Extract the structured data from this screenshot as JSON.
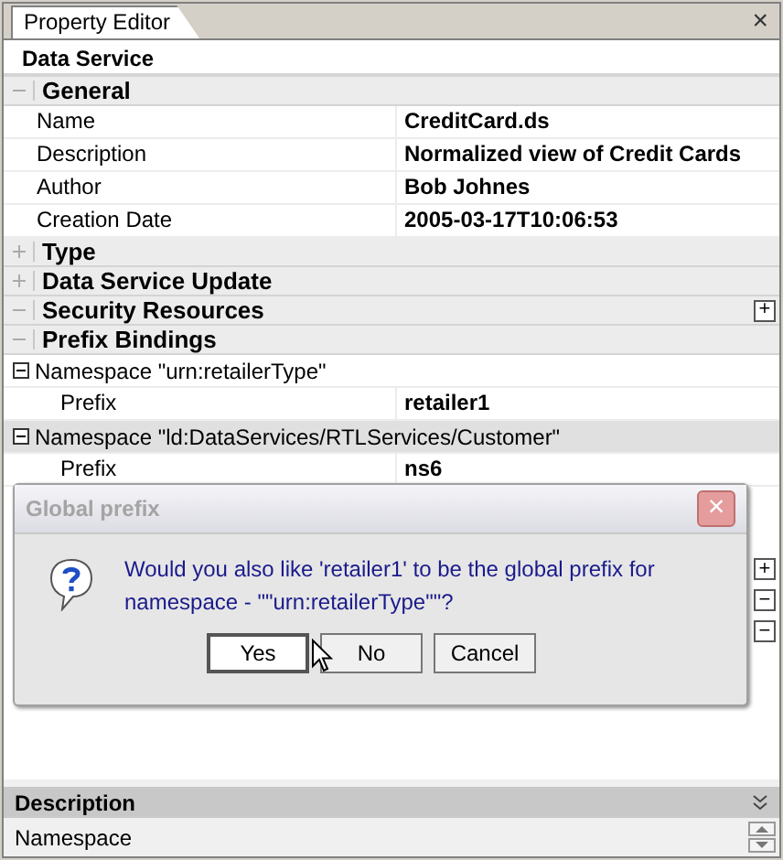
{
  "tab": {
    "label": "Property Editor",
    "close": "×"
  },
  "object_title": "Data Service",
  "rows": [
    {
      "kind": "category",
      "label": "General",
      "expanded": true
    },
    {
      "kind": "property",
      "name": "Name",
      "value": "CreditCard.ds"
    },
    {
      "kind": "property",
      "name": "Description",
      "value": "Normalized view of Credit Cards"
    },
    {
      "kind": "property",
      "name": "Author",
      "value": "Bob Johnes"
    },
    {
      "kind": "property",
      "name": "Creation Date",
      "value": "2005-03-17T10:06:53"
    },
    {
      "kind": "category",
      "label": "Type",
      "expanded": false
    },
    {
      "kind": "category",
      "label": "Data Service Update",
      "expanded": false
    },
    {
      "kind": "category",
      "label": "Security Resources",
      "expanded": true,
      "add_button": "+"
    },
    {
      "kind": "category",
      "label": "Prefix Bindings",
      "expanded": true
    },
    {
      "kind": "namespace",
      "label": "Namespace \"urn:retailerType\"",
      "expanded": true,
      "selected": false
    },
    {
      "kind": "subproperty",
      "name": "Prefix",
      "value": "retailer1"
    },
    {
      "kind": "namespace",
      "label": "Namespace \"ld:DataServices/RTLServices/Customer\"",
      "expanded": true,
      "selected": true
    },
    {
      "kind": "subproperty",
      "name": "Prefix",
      "value": "ns6"
    }
  ],
  "side_buttons": [
    "+",
    "−",
    "−"
  ],
  "dialog": {
    "title": "Global prefix",
    "close": "×",
    "message": "Would you also like 'retailer1' to be the global prefix for namespace - \"\"urn:retailerType\"\"?",
    "buttons": [
      {
        "label": "Yes",
        "focused": true
      },
      {
        "label": "No",
        "focused": false
      },
      {
        "label": "Cancel",
        "focused": false
      }
    ]
  },
  "description_panel": {
    "title": "Description",
    "text": "Namespace"
  }
}
